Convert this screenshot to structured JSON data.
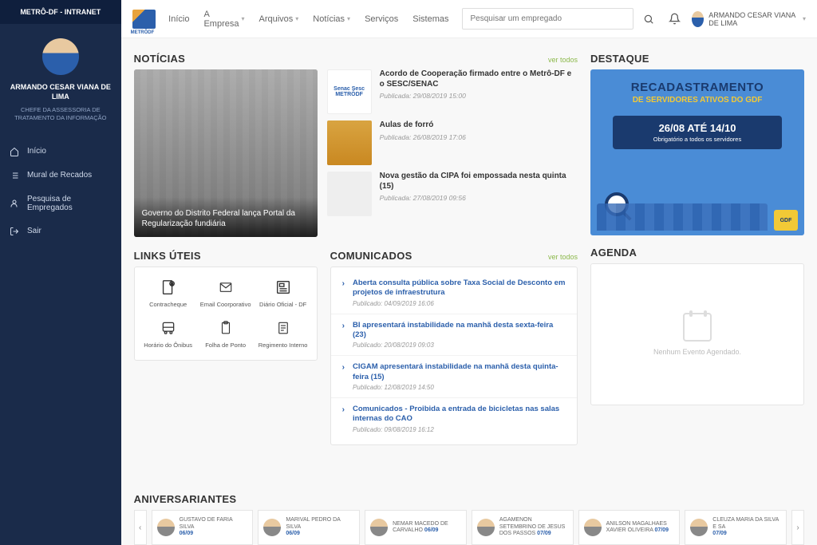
{
  "sidebar": {
    "header": "METRÔ-DF - INTRANET",
    "profile": {
      "name": "ARMANDO CESAR VIANA DE LIMA",
      "role": "CHEFE DA ASSESSORIA DE TRATAMENTO DA INFORMAÇÃO"
    },
    "nav": [
      {
        "label": "Início"
      },
      {
        "label": "Mural de Recados"
      },
      {
        "label": "Pesquisa de Empregados"
      },
      {
        "label": "Sair"
      }
    ]
  },
  "topbar": {
    "logo_text": "METRÔDF",
    "nav": [
      {
        "label": "Início",
        "dropdown": false
      },
      {
        "label": "A Empresa",
        "dropdown": true
      },
      {
        "label": "Arquivos",
        "dropdown": true
      },
      {
        "label": "Notícias",
        "dropdown": true
      },
      {
        "label": "Serviços",
        "dropdown": false
      },
      {
        "label": "Sistemas",
        "dropdown": false
      }
    ],
    "search_placeholder": "Pesquisar um empregado",
    "user_name": "ARMANDO CESAR VIANA DE LIMA"
  },
  "noticias": {
    "title": "NOTÍCIAS",
    "ver_todos": "ver todos",
    "hero_caption": "Governo do Distrito Federal lança Portal da Regularização fundiária",
    "items": [
      {
        "title": "Acordo de Cooperação firmado entre o Metrô-DF e o SESC/SENAC",
        "meta": "Publicada: 29/08/2019 15:00"
      },
      {
        "title": "Aulas de forró",
        "meta": "Publicada: 26/08/2019 17:06"
      },
      {
        "title": "Nova gestão da CIPA foi empossada nesta quinta (15)",
        "meta": "Publicada: 27/08/2019 09:56"
      }
    ]
  },
  "links": {
    "title": "LINKS ÚTEIS",
    "items": [
      {
        "label": "Contracheque"
      },
      {
        "label": "Email Coorporativo"
      },
      {
        "label": "Diário Oficial - DF"
      },
      {
        "label": "Horário do Ônibus"
      },
      {
        "label": "Folha de Ponto"
      },
      {
        "label": "Regimento Interno"
      }
    ]
  },
  "comunicados": {
    "title": "COMUNICADOS",
    "ver_todos": "ver todos",
    "items": [
      {
        "title": "Aberta consulta pública sobre Taxa Social de Desconto em projetos de infraestrutura",
        "meta": "Publicado: 04/09/2019 16:06"
      },
      {
        "title": "BI apresentará instabilidade na manhã desta sexta-feira (23)",
        "meta": "Publicado: 20/08/2019 09:03"
      },
      {
        "title": "CIGAM apresentará instabilidade na manhã desta quinta-feira (15)",
        "meta": "Publicado: 12/08/2019 14:50"
      },
      {
        "title": "Comunicados - Proibida a entrada de bicicletas nas salas internas do CAO",
        "meta": "Publicado: 09/08/2019 16:12"
      }
    ]
  },
  "destaque": {
    "title": "DESTAQUE",
    "h1": "RECADASTRAMENTO",
    "h2": "DE SERVIDORES ATIVOS DO GDF",
    "date": "26/08 ATÉ 14/10",
    "sub": "Obrigatório a todos os servidores",
    "badge": "GDF"
  },
  "agenda": {
    "title": "AGENDA",
    "empty": "Nenhum Evento Agendado."
  },
  "aniversariantes": {
    "title": "ANIVERSARIANTES",
    "items": [
      {
        "name": "GUSTAVO DE FARIA SILVA",
        "date": "06/09"
      },
      {
        "name": "MARIVAL PEDRO DA SILVA",
        "date": "06/09"
      },
      {
        "name": "NEMAR MACEDO DE CARVALHO",
        "date": "06/09"
      },
      {
        "name": "AGAMENON SETEMBRINO DE JESUS DOS PASSOS",
        "date": "07/09"
      },
      {
        "name": "ANILSON MAGALHAES XAVIER OLIVEIRA",
        "date": "07/09"
      },
      {
        "name": "CLEUZA MARIA DA SILVA E SA",
        "date": "07/09"
      }
    ]
  }
}
